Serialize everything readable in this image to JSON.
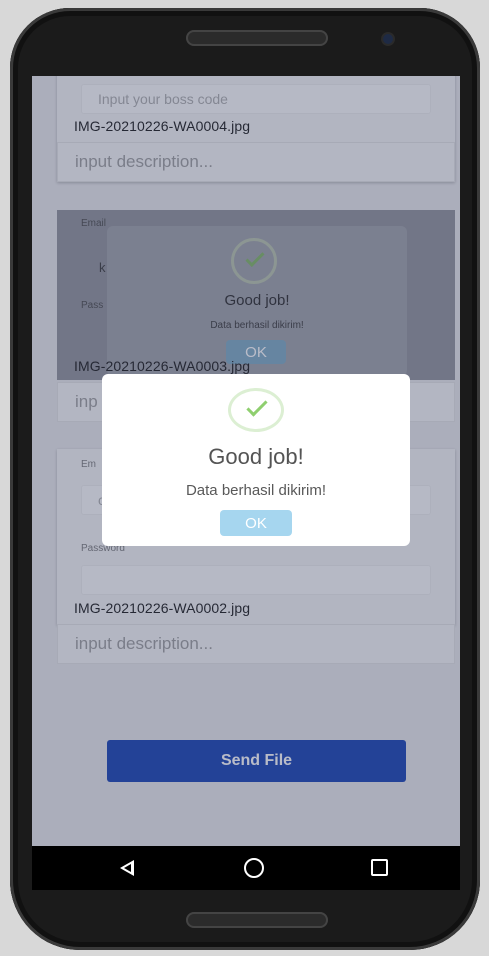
{
  "screen": {
    "top_card": {
      "boss_code_placeholder": "Input your boss code",
      "filename": "IMG-20210226-WA0004.jpg",
      "description_placeholder": "input description..."
    },
    "middle_card": {
      "email_label": "Email",
      "email_value_fragment": "k",
      "password_label": "Pass",
      "filename": "IMG-20210226-WA0003.jpg",
      "description_placeholder": "inp"
    },
    "bottom_card": {
      "email_label": "Em",
      "email_value_fragment": "c",
      "password_label": "Password",
      "filename": "IMG-20210226-WA0002.jpg",
      "description_placeholder": "input description..."
    },
    "send_button_label": "Send File"
  },
  "background_dialog": {
    "title": "Good job!",
    "message": "Data berhasil dikirim!",
    "ok_label": "OK"
  },
  "dialog": {
    "title": "Good job!",
    "message": "Data berhasil dikirim!",
    "ok_label": "OK",
    "icon": "success-check-icon"
  },
  "colors": {
    "primary_button": "#0e3bb0",
    "ok_button": "#a6d6ef",
    "success": "#8fcf6f"
  },
  "navbar": {
    "icons": [
      "back-icon",
      "home-icon",
      "recent-apps-icon"
    ]
  }
}
